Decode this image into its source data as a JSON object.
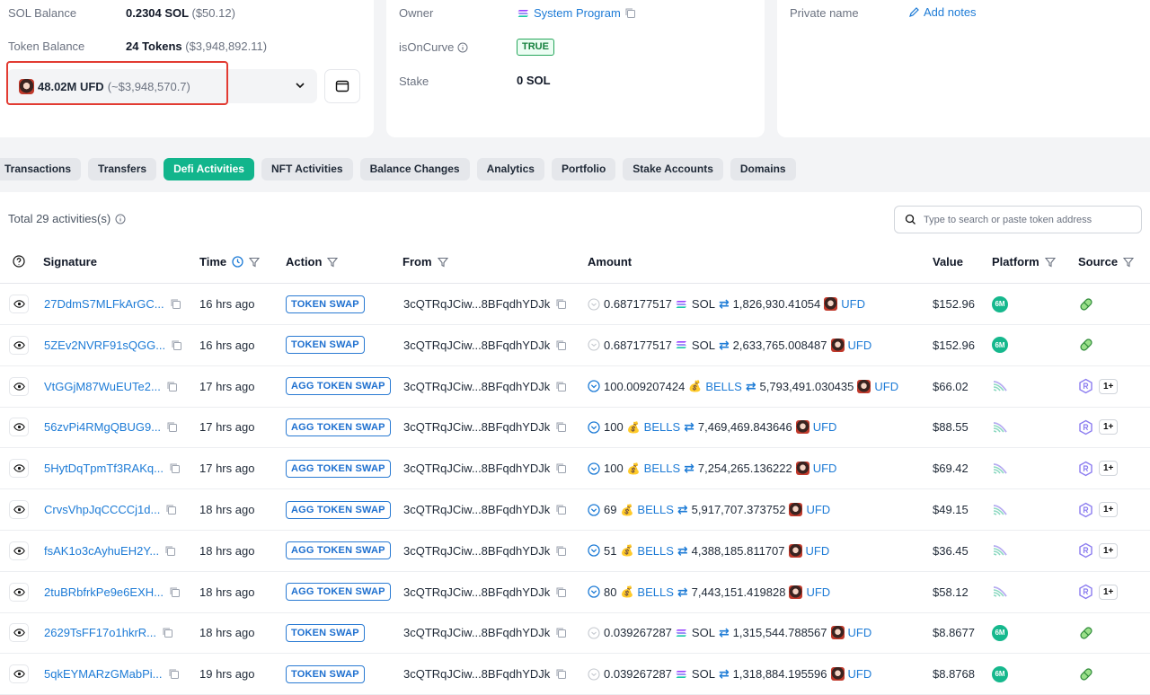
{
  "overview": {
    "sol_balance_label": "SOL Balance",
    "sol_balance_value": "0.2304 SOL",
    "sol_balance_usd": "($50.12)",
    "token_balance_label": "Token Balance",
    "token_balance_value": "24 Tokens",
    "token_balance_usd": "($3,948,892.11)",
    "selected_token_amount": "48.02M UFD",
    "selected_token_usd": "(~$3,948,570.7)"
  },
  "account": {
    "owner_label": "Owner",
    "owner_value": "System Program",
    "oncurve_label": "isOnCurve",
    "oncurve_value": "TRUE",
    "stake_label": "Stake",
    "stake_value": "0 SOL"
  },
  "more_info": {
    "private_name_label": "Private name",
    "add_notes": "Add notes"
  },
  "tabs": [
    {
      "label": "Transactions"
    },
    {
      "label": "Transfers"
    },
    {
      "label": "Defi Activities"
    },
    {
      "label": "NFT Activities"
    },
    {
      "label": "Balance Changes"
    },
    {
      "label": "Analytics"
    },
    {
      "label": "Portfolio"
    },
    {
      "label": "Stake Accounts"
    },
    {
      "label": "Domains"
    }
  ],
  "activities": {
    "total_text": "Total 29 activities(s)",
    "search_placeholder": "Type to search or paste token address",
    "columns": {
      "signature": "Signature",
      "time": "Time",
      "action": "Action",
      "from": "From",
      "amount": "Amount",
      "value": "Value",
      "platform": "Platform",
      "source": "Source"
    },
    "rows": [
      {
        "signature": "27DdmS7MLFkArGC...",
        "time": "16 hrs ago",
        "action": "TOKEN SWAP",
        "from": "3cQTRqJCiw...8BFqdhYDJk",
        "amount_in": "0.687177517",
        "token_in": "SOL",
        "amount_out": "1,826,930.41054",
        "token_out": "UFD",
        "value": "$152.96"
      },
      {
        "signature": "5ZEv2NVRF91sQGG...",
        "time": "16 hrs ago",
        "action": "TOKEN SWAP",
        "from": "3cQTRqJCiw...8BFqdhYDJk",
        "amount_in": "0.687177517",
        "token_in": "SOL",
        "amount_out": "2,633,765.008487",
        "token_out": "UFD",
        "value": "$152.96"
      },
      {
        "signature": "VtGGjM87WuEUTe2...",
        "time": "17 hrs ago",
        "action": "AGG TOKEN SWAP",
        "from": "3cQTRqJCiw...8BFqdhYDJk",
        "amount_in": "100.009207424",
        "token_in": "BELLS",
        "amount_out": "5,793,491.030435",
        "token_out": "UFD",
        "value": "$66.02"
      },
      {
        "signature": "56zvPi4RMgQBUG9...",
        "time": "17 hrs ago",
        "action": "AGG TOKEN SWAP",
        "from": "3cQTRqJCiw...8BFqdhYDJk",
        "amount_in": "100",
        "token_in": "BELLS",
        "amount_out": "7,469,469.843646",
        "token_out": "UFD",
        "value": "$88.55"
      },
      {
        "signature": "5HytDqTpmTf3RAKq...",
        "time": "17 hrs ago",
        "action": "AGG TOKEN SWAP",
        "from": "3cQTRqJCiw...8BFqdhYDJk",
        "amount_in": "100",
        "token_in": "BELLS",
        "amount_out": "7,254,265.136222",
        "token_out": "UFD",
        "value": "$69.42"
      },
      {
        "signature": "CrvsVhpJqCCCCj1d...",
        "time": "18 hrs ago",
        "action": "AGG TOKEN SWAP",
        "from": "3cQTRqJCiw...8BFqdhYDJk",
        "amount_in": "69",
        "token_in": "BELLS",
        "amount_out": "5,917,707.373752",
        "token_out": "UFD",
        "value": "$49.15"
      },
      {
        "signature": "fsAK1o3cAyhuEH2Y...",
        "time": "18 hrs ago",
        "action": "AGG TOKEN SWAP",
        "from": "3cQTRqJCiw...8BFqdhYDJk",
        "amount_in": "51",
        "token_in": "BELLS",
        "amount_out": "4,388,185.811707",
        "token_out": "UFD",
        "value": "$36.45"
      },
      {
        "signature": "2tuBRbfrkPe9e6EXH...",
        "time": "18 hrs ago",
        "action": "AGG TOKEN SWAP",
        "from": "3cQTRqJCiw...8BFqdhYDJk",
        "amount_in": "80",
        "token_in": "BELLS",
        "amount_out": "7,443,151.419828",
        "token_out": "UFD",
        "value": "$58.12"
      },
      {
        "signature": "2629TsFF17o1hkrR...",
        "time": "18 hrs ago",
        "action": "TOKEN SWAP",
        "from": "3cQTRqJCiw...8BFqdhYDJk",
        "amount_in": "0.039267287",
        "token_in": "SOL",
        "amount_out": "1,315,544.788567",
        "token_out": "UFD",
        "value": "$8.8677"
      },
      {
        "signature": "5qkEYMARzGMabPi...",
        "time": "19 hrs ago",
        "action": "TOKEN SWAP",
        "from": "3cQTRqJCiw...8BFqdhYDJk",
        "amount_in": "0.039267287",
        "token_in": "SOL",
        "amount_out": "1,318,884.195596",
        "token_out": "UFD",
        "value": "$8.8768"
      }
    ],
    "source_extra_label": "1+",
    "platform_badge_label": "6M"
  },
  "colors": {
    "accent": "#12b58c",
    "link": "#1d7bd6",
    "highlight_border": "#e23b32"
  }
}
